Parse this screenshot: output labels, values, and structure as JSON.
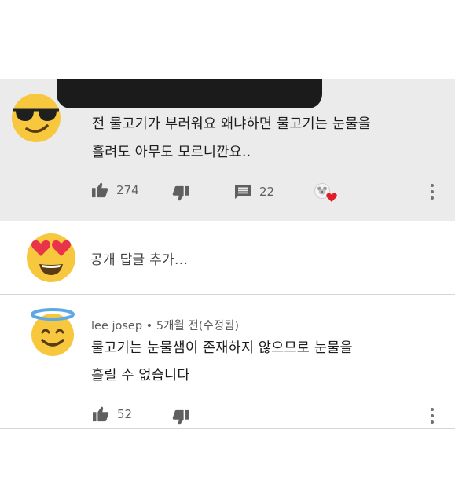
{
  "top_comment": {
    "text_line1": "전 물고기가 부러워요 왜냐하면 물고기는 눈물을",
    "text_line2": "흘려도 아무도 모르니깐요..",
    "like_count": "274",
    "reply_count": "22"
  },
  "reply_box": {
    "placeholder": "공개 답글 추가..."
  },
  "reply_comment": {
    "author": "lee josep",
    "separator": "•",
    "time": "5개월 전(수정됨)",
    "text_line1": "물고기는 눈물샘이 존재하지 않으므로 눈물을",
    "text_line2": "흘릴 수 없습니다",
    "like_count": "52"
  },
  "colors": {
    "top_bg": "#ebebeb",
    "emoji_yellow": "#f7c83e",
    "heart_red": "#e11d2a",
    "halo_blue": "#5fa8e6"
  },
  "icons": [
    "sunglasses-emoji-icon",
    "heart-eyes-emoji-icon",
    "halo-emoji-icon",
    "thumbs-up-icon",
    "thumbs-down-icon",
    "reply-icon",
    "heart-icon",
    "more-vert-icon"
  ]
}
